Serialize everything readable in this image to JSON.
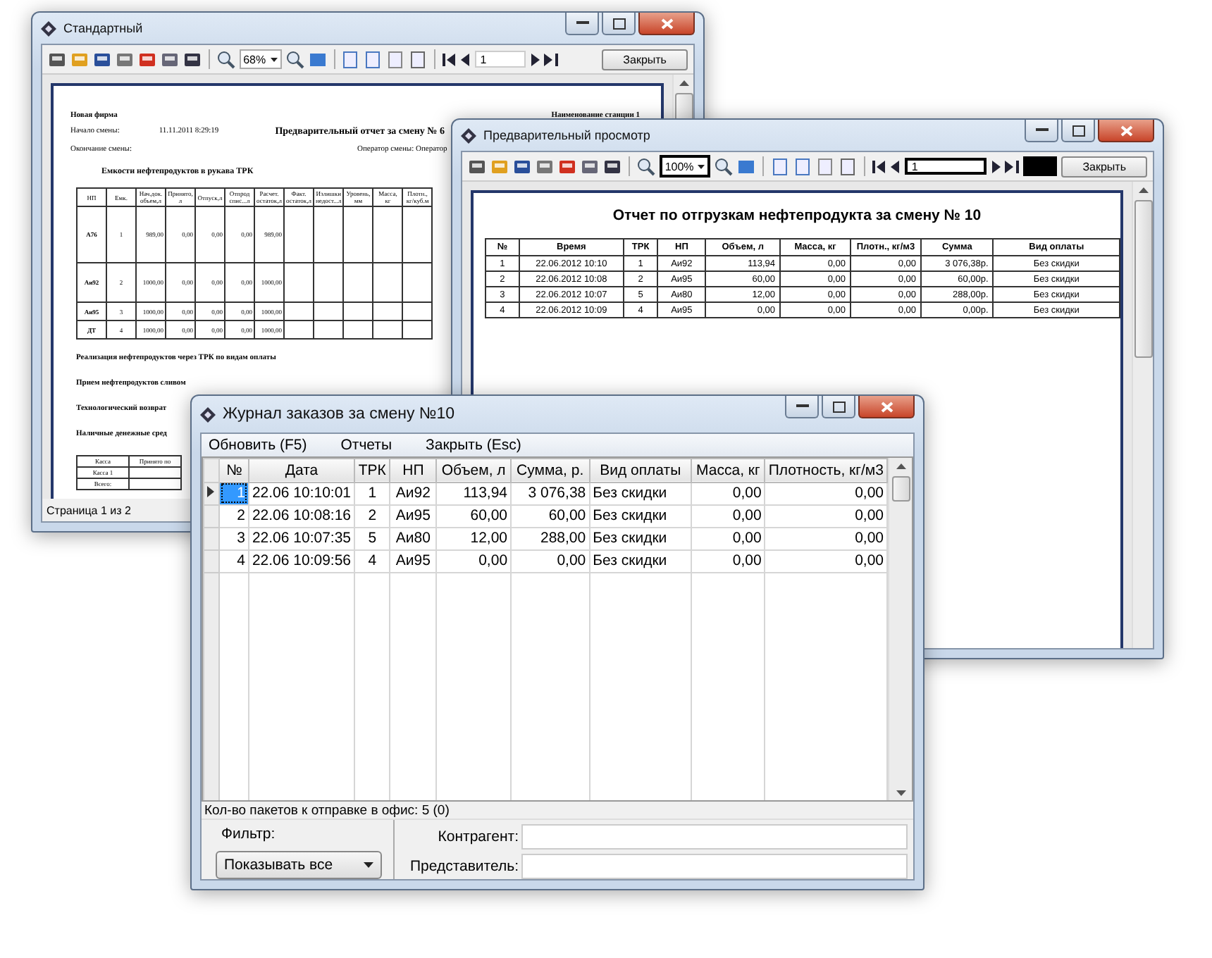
{
  "standard_window": {
    "title": "Стандартный",
    "toolbar": {
      "zoom": "68%",
      "page": "1",
      "close_button": "Закрыть"
    },
    "report": {
      "company": "Новая фирма",
      "station": "Наименование станции 1",
      "shift_start_label": "Начало смены:",
      "shift_start": "11.11.2011 8:29:19",
      "title": "Предварительный отчет за смену № 6",
      "shift_end_label": "Окончание смены:",
      "operator": "Оператор смены: Оператор",
      "tanks_heading": "Емкости нефтепродуктов в рукава ТРК",
      "tank_columns": [
        "НП",
        "Емк.",
        "Нач.док. объем,л",
        "Принято, л",
        "Отпуск,л",
        "Отпрод спис...л",
        "Расчет. остаток,л",
        "Факт. остаток,л",
        "Излишки недост...л",
        "Уровень, мм",
        "Масса, кг",
        "Плотн., кг/куб.м"
      ],
      "tank_rows": [
        [
          "А76",
          "1",
          "989,00",
          "0,00",
          "0,00",
          "0,00",
          "989,00"
        ],
        [
          "Аи92",
          "2",
          "1000,00",
          "0,00",
          "0,00",
          "0,00",
          "1000,00"
        ],
        [
          "Аи95",
          "3",
          "1000,00",
          "0,00",
          "0,00",
          "0,00",
          "1000,00"
        ],
        [
          "ДТ",
          "4",
          "1000,00",
          "0,00",
          "0,00",
          "0,00",
          "1000,00"
        ]
      ],
      "sections": [
        "Реализация нефтепродуктов через ТРК по видам оплаты",
        "Прием нефтепродуктов сливом",
        "Технологический возврат",
        "Наличные денежные сред"
      ],
      "cash_columns": [
        "Касса",
        "Принято по"
      ],
      "cash_rows": [
        "Касса 1",
        "Всего:"
      ]
    },
    "status": "Страница 1 из 2"
  },
  "preview_window": {
    "title": "Предварительный просмотр",
    "toolbar": {
      "zoom": "100%",
      "page": "1",
      "close_button": "Закрыть"
    },
    "report": {
      "title": "Отчет по отгрузкам нефтепродукта за смену № 10",
      "columns": [
        "№",
        "Время",
        "ТРК",
        "НП",
        "Объем, л",
        "Масса, кг",
        "Плотн., кг/м3",
        "Сумма",
        "Вид оплаты"
      ],
      "rows": [
        [
          "1",
          "22.06.2012 10:10",
          "1",
          "Аи92",
          "113,94",
          "0,00",
          "0,00",
          "3 076,38р.",
          "Без скидки"
        ],
        [
          "2",
          "22.06.2012 10:08",
          "2",
          "Аи95",
          "60,00",
          "0,00",
          "0,00",
          "60,00р.",
          "Без скидки"
        ],
        [
          "3",
          "22.06.2012 10:07",
          "5",
          "Аи80",
          "12,00",
          "0,00",
          "0,00",
          "288,00р.",
          "Без скидки"
        ],
        [
          "4",
          "22.06.2012 10:09",
          "4",
          "Аи95",
          "0,00",
          "0,00",
          "0,00",
          "0,00р.",
          "Без скидки"
        ]
      ]
    }
  },
  "orders_window": {
    "title": "Журнал заказов за смену №10",
    "menu": [
      "Обновить (F5)",
      "Отчеты",
      "Закрыть (Esc)"
    ],
    "columns": [
      "№",
      "Дата",
      "ТРК",
      "НП",
      "Объем, л",
      "Сумма, р.",
      "Вид оплаты",
      "Масса, кг",
      "Плотность, кг/м3"
    ],
    "rows": [
      {
        "selected": true,
        "cells": [
          "1",
          "22.06 10:10:01",
          "1",
          "Аи92",
          "113,94",
          "3 076,38",
          "Без скидки",
          "0,00",
          "0,00"
        ]
      },
      {
        "selected": false,
        "cells": [
          "2",
          "22.06 10:08:16",
          "2",
          "Аи95",
          "60,00",
          "60,00",
          "Без скидки",
          "0,00",
          "0,00"
        ]
      },
      {
        "selected": false,
        "cells": [
          "3",
          "22.06 10:07:35",
          "5",
          "Аи80",
          "12,00",
          "288,00",
          "Без скидки",
          "0,00",
          "0,00"
        ]
      },
      {
        "selected": false,
        "cells": [
          "4",
          "22.06 10:09:56",
          "4",
          "Аи95",
          "0,00",
          "0,00",
          "Без скидки",
          "0,00",
          "0,00"
        ]
      }
    ],
    "status": "Кол-во пакетов к отправке в офис: 5 (0)",
    "filter": {
      "label": "Фильтр:",
      "value": "Показывать все"
    },
    "fields": [
      {
        "label": "Контрагент:"
      },
      {
        "label": "Представитель:"
      }
    ]
  }
}
